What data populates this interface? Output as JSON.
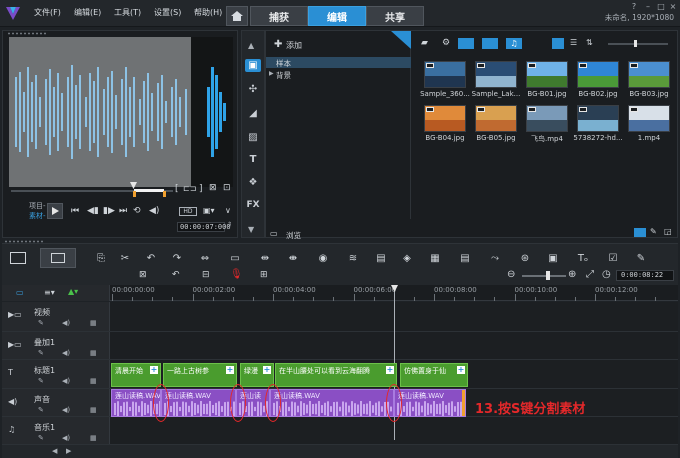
{
  "menu": [
    "文件(F)",
    "编辑(E)",
    "工具(T)",
    "设置(S)",
    "帮助(H)"
  ],
  "tabs": [
    {
      "label": "捕获"
    },
    {
      "label": "编辑"
    },
    {
      "label": "共享"
    }
  ],
  "project": {
    "name_resolution": "未命名, 1920*1080"
  },
  "preview": {
    "labels": [
      "项目-",
      "素材-"
    ],
    "timecode": "00:00:07:000"
  },
  "library": {
    "add_label": "添加",
    "folders": [
      "样本",
      "背景"
    ],
    "browse_label": "浏览",
    "items": [
      {
        "name": "Sample_360...",
        "icon": "video-thumb"
      },
      {
        "name": "Sample_Lak...",
        "icon": "video-thumb"
      },
      {
        "name": "BG-B01.jpg",
        "icon": "image-thumb"
      },
      {
        "name": "BG-B02.jpg",
        "icon": "image-thumb"
      },
      {
        "name": "BG-B03.jpg",
        "icon": "image-thumb"
      },
      {
        "name": "BG-B04.jpg",
        "icon": "image-thumb"
      },
      {
        "name": "BG-B05.jpg",
        "icon": "image-thumb"
      },
      {
        "name": "飞鸟.mp4",
        "icon": "video-thumb"
      },
      {
        "name": "5738272-hd...",
        "icon": "video-thumb"
      },
      {
        "name": "1.mp4",
        "icon": "video-thumb"
      }
    ]
  },
  "timeline": {
    "zoom_timecode": "0:00:08:22",
    "ruler_ticks": [
      "00:00:00:00",
      "00:00:02:00",
      "00:00:04:00",
      "00:00:06:00",
      "00:00:08:00",
      "00:00:10:00",
      "00:00:12:00"
    ],
    "tracks": [
      {
        "name": "视频",
        "icon": "video-track-icon"
      },
      {
        "name": "叠加1",
        "icon": "overlay-track-icon"
      },
      {
        "name": "标题1",
        "icon": "title-track-icon"
      },
      {
        "name": "声音",
        "icon": "voice-track-icon"
      },
      {
        "name": "音乐1",
        "icon": "music-track-icon"
      }
    ],
    "title_clips": [
      "清晨开始",
      "一路上古树参",
      "绿漫",
      "在半山腰处可以看到云海翻腾",
      "仿佛置身于仙"
    ],
    "audio_clips": [
      "莲山读稿.WAV",
      "莲山读稿.WAV",
      "莲山读",
      "莲山读稿.WAV",
      "莲山读稿.WAV"
    ]
  },
  "annotation": "13.按S键分割素材",
  "colors": {
    "accent": "#2a8fd4",
    "title_clip": "#4a9c2e",
    "audio_clip": "#8a4fc4",
    "annotation": "#e4282a"
  }
}
